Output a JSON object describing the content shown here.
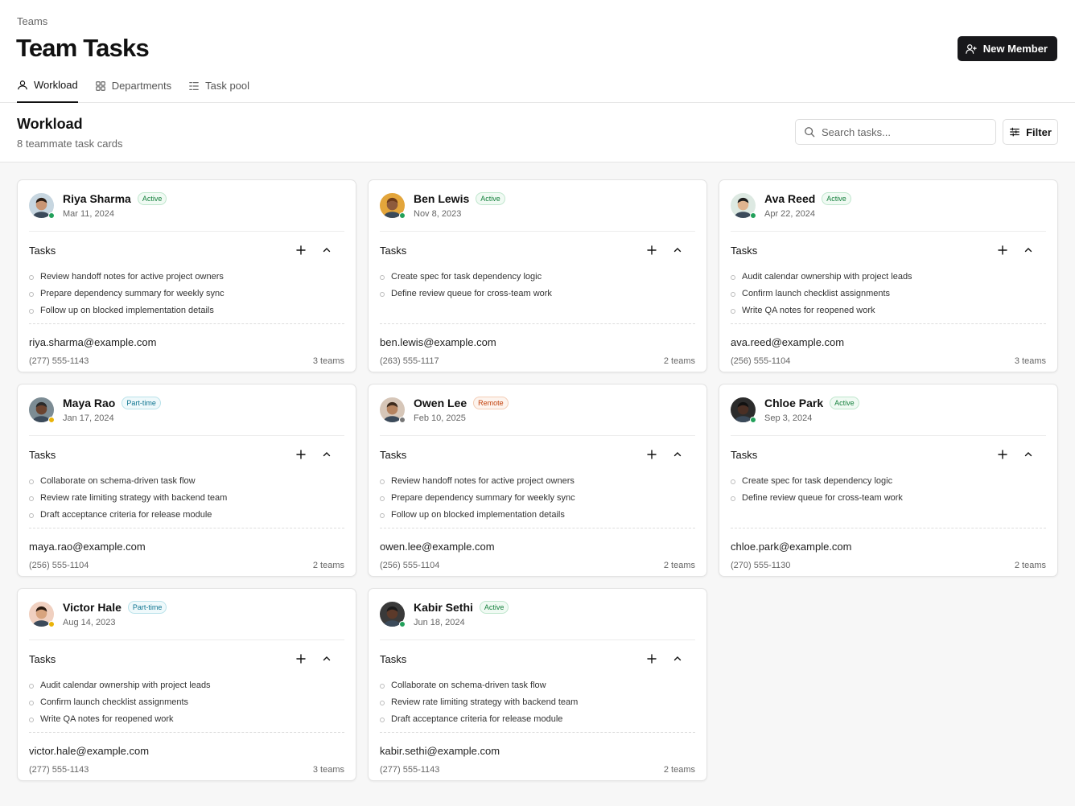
{
  "header": {
    "breadcrumb": "Teams",
    "title": "Team Tasks",
    "new_member_label": "New Member",
    "tabs": [
      {
        "label": "Workload",
        "icon": "user-icon",
        "active": true
      },
      {
        "label": "Departments",
        "icon": "grid-icon",
        "active": false
      },
      {
        "label": "Task pool",
        "icon": "list-icon",
        "active": false
      }
    ]
  },
  "workload": {
    "title": "Workload",
    "subtitle": "8 teammate task cards",
    "search_placeholder": "Search tasks...",
    "filter_label": "Filter"
  },
  "colors": {
    "active_badge": "#15803d",
    "parttime_badge": "#0e7490",
    "remote_badge": "#c2410c",
    "status_green": "#22a05a",
    "status_yellow": "#eab308",
    "status_gray": "#777777"
  },
  "cards": [
    {
      "name": "Riya Sharma",
      "badge": "Active",
      "badge_type": "active",
      "status": "green",
      "date": "Mar 11, 2024",
      "tasks_label": "Tasks",
      "tasks": [
        "Review handoff notes for active project owners",
        "Prepare dependency summary for weekly sync",
        "Follow up on blocked implementation details"
      ],
      "email": "riya.sharma@example.com",
      "phone": "(277) 555-1143",
      "teams": "3 teams"
    },
    {
      "name": "Ben Lewis",
      "badge": "Active",
      "badge_type": "active",
      "status": "green",
      "date": "Nov 8, 2023",
      "tasks_label": "Tasks",
      "tasks": [
        "Create spec for task dependency logic",
        "Define review queue for cross-team work"
      ],
      "email": "ben.lewis@example.com",
      "phone": "(263) 555-1117",
      "teams": "2 teams"
    },
    {
      "name": "Ava Reed",
      "badge": "Active",
      "badge_type": "active",
      "status": "green",
      "date": "Apr 22, 2024",
      "tasks_label": "Tasks",
      "tasks": [
        "Audit calendar ownership with project leads",
        "Confirm launch checklist assignments",
        "Write QA notes for reopened work"
      ],
      "email": "ava.reed@example.com",
      "phone": "(256) 555-1104",
      "teams": "3 teams"
    },
    {
      "name": "Maya Rao",
      "badge": "Part-time",
      "badge_type": "parttime",
      "status": "yellow",
      "date": "Jan 17, 2024",
      "tasks_label": "Tasks",
      "tasks": [
        "Collaborate on schema-driven task flow",
        "Review rate limiting strategy with backend team",
        "Draft acceptance criteria for release module"
      ],
      "email": "maya.rao@example.com",
      "phone": "(256) 555-1104",
      "teams": "2 teams"
    },
    {
      "name": "Owen Lee",
      "badge": "Remote",
      "badge_type": "remote",
      "status": "gray",
      "date": "Feb 10, 2025",
      "tasks_label": "Tasks",
      "tasks": [
        "Review handoff notes for active project owners",
        "Prepare dependency summary for weekly sync",
        "Follow up on blocked implementation details"
      ],
      "email": "owen.lee@example.com",
      "phone": "(256) 555-1104",
      "teams": "2 teams"
    },
    {
      "name": "Chloe Park",
      "badge": "Active",
      "badge_type": "active",
      "status": "green",
      "date": "Sep 3, 2024",
      "tasks_label": "Tasks",
      "tasks": [
        "Create spec for task dependency logic",
        "Define review queue for cross-team work"
      ],
      "email": "chloe.park@example.com",
      "phone": "(270) 555-1130",
      "teams": "2 teams"
    },
    {
      "name": "Victor Hale",
      "badge": "Part-time",
      "badge_type": "parttime",
      "status": "yellow",
      "date": "Aug 14, 2023",
      "tasks_label": "Tasks",
      "tasks": [
        "Audit calendar ownership with project leads",
        "Confirm launch checklist assignments",
        "Write QA notes for reopened work"
      ],
      "email": "victor.hale@example.com",
      "phone": "(277) 555-1143",
      "teams": "3 teams"
    },
    {
      "name": "Kabir Sethi",
      "badge": "Active",
      "badge_type": "active",
      "status": "green",
      "date": "Jun 18, 2024",
      "tasks_label": "Tasks",
      "tasks": [
        "Collaborate on schema-driven task flow",
        "Review rate limiting strategy with backend team",
        "Draft acceptance criteria for release module"
      ],
      "email": "kabir.sethi@example.com",
      "phone": "(277) 555-1143",
      "teams": "2 teams"
    }
  ]
}
